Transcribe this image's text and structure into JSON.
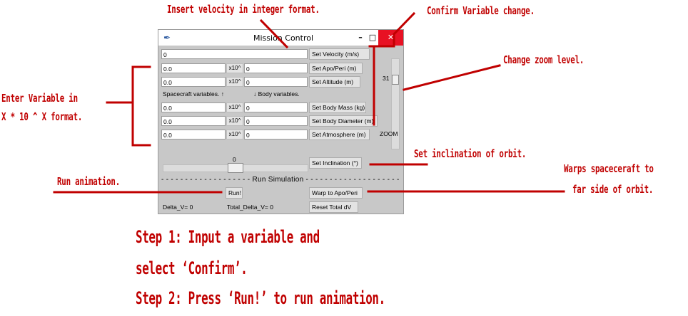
{
  "window": {
    "title": "Mission Control",
    "close_label": "✕",
    "minimize_label": "–",
    "maximize_label": "□",
    "app_icon": "feather-icon"
  },
  "velocity": {
    "value": "0",
    "button": "Set Velocity (m/s)"
  },
  "apo_peri": {
    "mantissa": "0.0",
    "exp_label": "x10^",
    "exponent": "0",
    "button": "Set Apo/Peri (m)"
  },
  "altitude": {
    "mantissa": "0.0",
    "exp_label": "x10^",
    "exponent": "0",
    "button": "Set Altitude (m)"
  },
  "section_labels": {
    "spacecraft": "Spacecraft variables. ↑",
    "body": "↓ Body variables."
  },
  "body_mass": {
    "mantissa": "0.0",
    "exp_label": "x10^",
    "exponent": "0",
    "button": "Set Body Mass (kg)"
  },
  "body_diameter": {
    "mantissa": "0.0",
    "exp_label": "x10^",
    "exponent": "0",
    "button": "Set Body Diameter (m)"
  },
  "atmosphere": {
    "mantissa": "0.0",
    "exp_label": "x10^",
    "exponent": "0",
    "button": "Set Atmosphere (m)"
  },
  "zoom": {
    "value": "31",
    "label": "ZOOM"
  },
  "inclination": {
    "value": "0",
    "button": "Set Inclination (°)"
  },
  "run_section": "- - - - - - - - - - - - - - - - - - - Run Simulation - - - - - - - - - - - - - - - - - - - - - -",
  "run_button": "Run!",
  "warp_button": "Warp to Apo/Peri",
  "reset_button": "Reset Total dV",
  "delta_v": "Delta_V= 0",
  "total_delta_v": "Total_Delta_V= 0",
  "annotations": {
    "insert_velocity": "Insert velocity in integer format.",
    "confirm_change": "Confirm Variable change.",
    "zoom_level": "Change zoom level.",
    "enter_variable_1": "Enter Variable in",
    "enter_variable_2": "X * 10 ^ X format.",
    "set_inclination": "Set inclination of orbit.",
    "warps_1": "Warps spaceceraft to",
    "warps_2": "far side of orbit.",
    "run_animation": "Run animation.",
    "step1_a": "Step 1: Input a variable and",
    "step1_b": "select ‘Confirm’.",
    "step2": "Step 2: Press ‘Run!’ to run animation."
  },
  "colors": {
    "annotation": "#c00000",
    "window_bg": "#c8c8c8",
    "close": "#e81123"
  }
}
